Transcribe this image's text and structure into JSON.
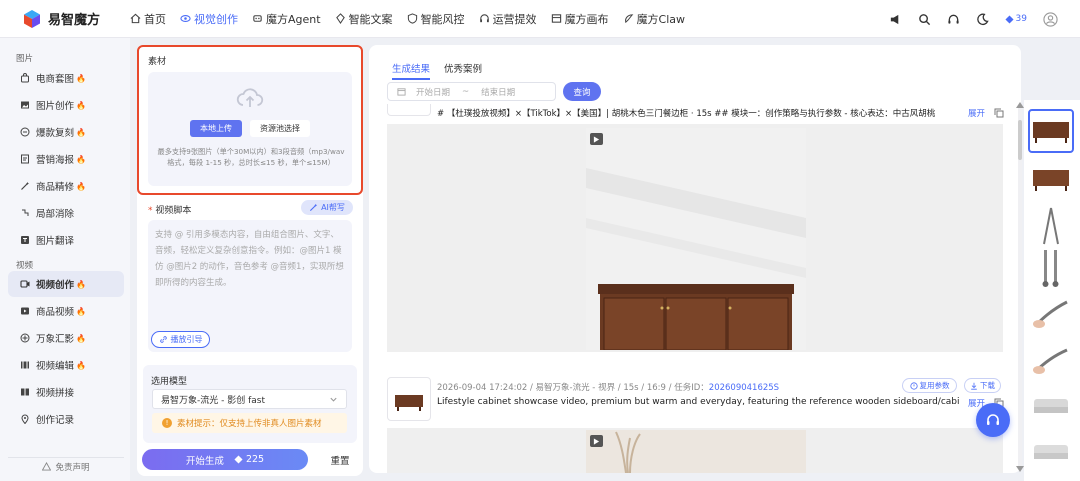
{
  "brand": {
    "name": "易智魔方"
  },
  "nav": [
    {
      "label": "首页",
      "icon": "home-icon"
    },
    {
      "label": "视觉创作",
      "icon": "eye-icon"
    },
    {
      "label": "魔方Agent",
      "icon": "agent-icon"
    },
    {
      "label": "智能文案",
      "icon": "pen-icon"
    },
    {
      "label": "智能风控",
      "icon": "shield-icon"
    },
    {
      "label": "运营提效",
      "icon": "headset-icon"
    },
    {
      "label": "魔方画布",
      "icon": "canvas-icon"
    },
    {
      "label": "魔方Claw",
      "icon": "claw-icon"
    }
  ],
  "topRight": {
    "credits": "39"
  },
  "sidebar": {
    "section1": "图片",
    "section2": "视频",
    "items": [
      {
        "label": "电商套图",
        "hot": "🔥"
      },
      {
        "label": "图片创作",
        "hot": "🔥"
      },
      {
        "label": "爆款复刻",
        "hot": "🔥"
      },
      {
        "label": "营销海报",
        "hot": "🔥"
      },
      {
        "label": "商品精修",
        "hot": "🔥"
      },
      {
        "label": "局部消除",
        "hot": ""
      },
      {
        "label": "图片翻译",
        "hot": ""
      },
      {
        "label": "视频创作",
        "hot": "🔥"
      },
      {
        "label": "商品视频",
        "hot": "🔥"
      },
      {
        "label": "万象汇影",
        "hot": "🔥"
      },
      {
        "label": "视频编辑",
        "hot": "🔥"
      },
      {
        "label": "视频拼接",
        "hot": ""
      },
      {
        "label": "创作记录",
        "hot": ""
      }
    ],
    "footer": "免责声明"
  },
  "left": {
    "materialLabel": "素材",
    "uploadLocal": "本地上传",
    "uploadPool": "资源池选择",
    "uploadDesc": "最多支持9张图片（单个30M以内）和3段音频（mp3/wav格式，每段 1-15 秒，总时长≤15 秒，单个≤15M）",
    "scriptLabel": "视频脚本",
    "aiBtn": "AI帮写",
    "scriptPlaceholder": "支持 @ 引用多模态内容，自由组合图片、文字、音频，轻松定义复杂创意指令。例如：@图片1 模仿 @图片2 的动作，音色参考 @音频1，实现所想即所得的内容生成。",
    "guideBtn": "播放引导",
    "modelLabel": "选用模型",
    "modelValue": "易智万象-流光 - 影创 fast",
    "tip": "素材提示：仅支持上传非真人图片素材",
    "genBtn": "开始生成",
    "genCost": "225",
    "resetBtn": "重置"
  },
  "main": {
    "tab1": "生成结果",
    "tab2": "优秀案例",
    "startDate": "开始日期",
    "dateSep": "~",
    "endDate": "结束日期",
    "queryBtn": "查询",
    "r1Title": "# 【杜璞投放视频】×【TikTok】×【美国】| 胡桃木色三门餐边柜 · 15s ## 模块一：创作策略与执行参数 - 核心表达：中古风胡桃",
    "expand": "展开",
    "r2Meta1": "2026-09-04 17:24:02 / 易智万象-流光 - 视界 / 15s / 16:9 / 任务ID：",
    "r2TaskId": "202609041625S",
    "r2Reuse": "复用参数",
    "r2Download": "下载",
    "r2Title": "Lifestyle cabinet showcase video, premium but warm and everyday, featuring the reference wooden sideboard/cabinet"
  },
  "colors": {
    "accent": "#4a6cf7",
    "highlight": "#e8492c"
  }
}
